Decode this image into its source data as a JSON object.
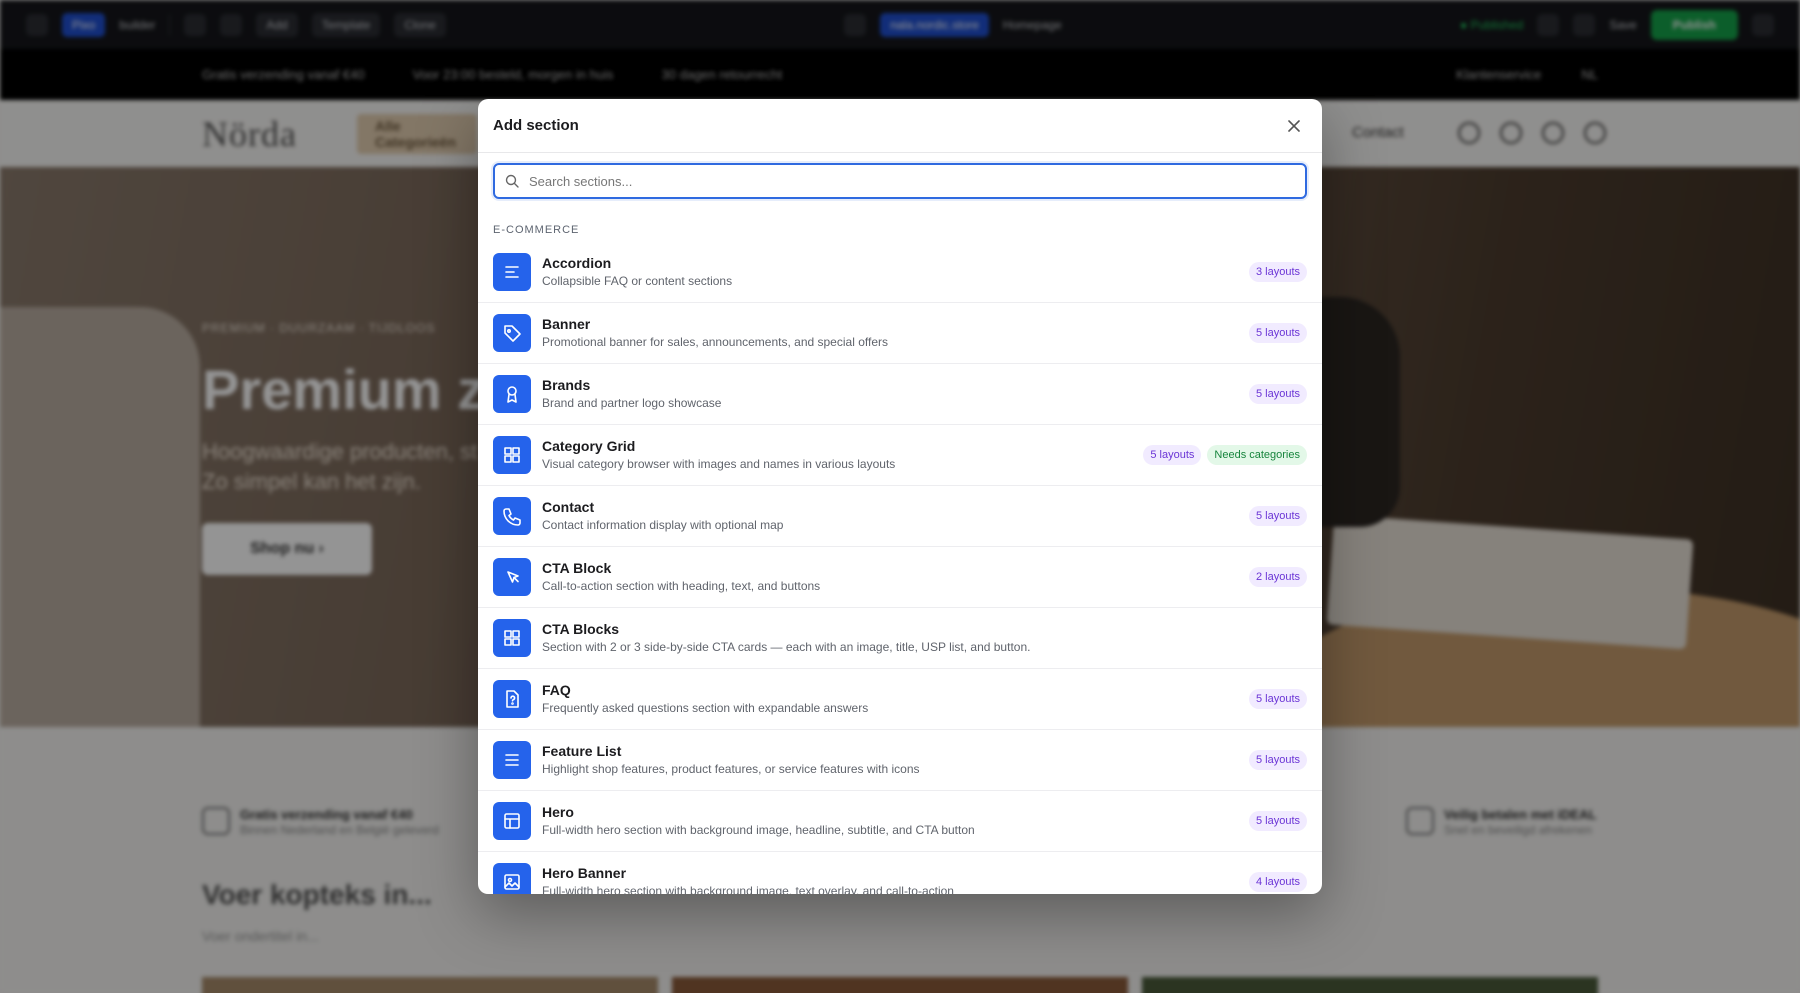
{
  "editor": {
    "brand_chip": "Pixo",
    "brand_label": "builder",
    "tool_add": "Add",
    "tool_template": "Template",
    "tool_clone": "Clone",
    "store_chip": "nala.nordic.store",
    "page_label": "Homepage",
    "status": "● Published",
    "save_label": "Save",
    "publish_label": "Publish"
  },
  "promo": {
    "items": [
      "Gratis verzending vanaf €40",
      "Voor 23:00 besteld, morgen in huis",
      "30 dagen retourrecht"
    ],
    "service": "Klantenservice",
    "language": "NL"
  },
  "store_nav": {
    "logo": "Nörda",
    "categories_button": "Alle Categorieën",
    "contact": "Contact"
  },
  "hero": {
    "kicker": "PREMIUM · DUURZAAM · TIJDLOOS",
    "title": "Premium zo",
    "subtitle_line1": "Hoogwaardige producten, st",
    "subtitle_line2": "Zo simpel kan het zijn.",
    "cta": "Shop nu  ›"
  },
  "usps": [
    {
      "title": "Gratis verzending vanaf €40",
      "sub": "Binnen Nederland en België geleverd"
    },
    {
      "title": "Veilig betalen met iDEAL",
      "sub": "Snel en beveiligd afrekenen"
    }
  ],
  "section_heading": "Voer kopteks in...",
  "section_subheading": "Voer ondertitel in...",
  "modal": {
    "title": "Add section",
    "search_placeholder": "Search sections...",
    "search_value": "",
    "group_label": "E-COMMERCE",
    "accent_color": "#2563eb",
    "sections": [
      {
        "icon": "accordion-icon",
        "name": "Accordion",
        "description": "Collapsible FAQ or content sections",
        "badges": [
          "3 layouts"
        ]
      },
      {
        "icon": "tag-icon",
        "name": "Banner",
        "description": "Promotional banner for sales, announcements, and special offers",
        "badges": [
          "5 layouts"
        ]
      },
      {
        "icon": "award-icon",
        "name": "Brands",
        "description": "Brand and partner logo showcase",
        "badges": [
          "5 layouts"
        ]
      },
      {
        "icon": "grid-icon",
        "name": "Category Grid",
        "description": "Visual category browser with images and names in various layouts",
        "badges": [
          "5 layouts",
          "Needs categories"
        ]
      },
      {
        "icon": "phone-icon",
        "name": "Contact",
        "description": "Contact information display with optional map",
        "badges": [
          "5 layouts"
        ]
      },
      {
        "icon": "pointer-icon",
        "name": "CTA Block",
        "description": "Call-to-action section with heading, text, and buttons",
        "badges": [
          "2 layouts"
        ]
      },
      {
        "icon": "grid-icon",
        "name": "CTA Blocks",
        "description": "Section with 2 or 3 side-by-side CTA cards — each with an image, title, USP list, and button.",
        "badges": []
      },
      {
        "icon": "file-question-icon",
        "name": "FAQ",
        "description": "Frequently asked questions section with expandable answers",
        "badges": [
          "5 layouts"
        ]
      },
      {
        "icon": "list-icon",
        "name": "Feature List",
        "description": "Highlight shop features, product features, or service features with icons",
        "badges": [
          "5 layouts"
        ]
      },
      {
        "icon": "layout-icon",
        "name": "Hero",
        "description": "Full-width hero section with background image, headline, subtitle, and CTA button",
        "badges": [
          "5 layouts"
        ]
      },
      {
        "icon": "image-icon",
        "name": "Hero Banner",
        "description": "Full-width hero section with background image, text overlay, and call-to-action",
        "badges": [
          "4 layouts"
        ]
      }
    ]
  }
}
